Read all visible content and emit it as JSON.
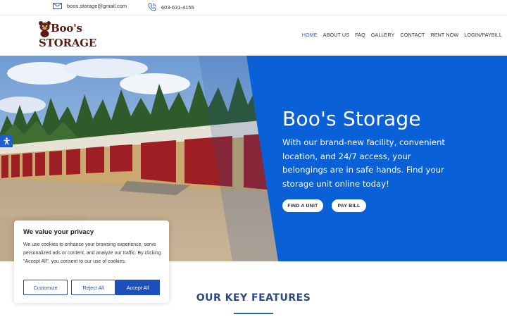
{
  "topbar": {
    "email": "boos.storage@gmail.com",
    "phone": "603-631-4155"
  },
  "logo": {
    "line1": "Boo's",
    "line2": "STORAGE"
  },
  "nav": {
    "items": [
      "HOME",
      "ABOUT US",
      "FAQ",
      "GALLERY",
      "CONTACT",
      "RENT NOW",
      "LOGIN/PAYBILL"
    ],
    "active": "HOME"
  },
  "hero": {
    "title": "Boo's Storage",
    "text": "With our brand-new facility, convenient location, and 24/7 access, your belongings are in safe hands. Find your storage unit online today!",
    "find_unit_label": "FIND A UNIT",
    "pay_bill_label": "PAY BILL"
  },
  "features": {
    "title": "OUR KEY FEATURES"
  },
  "cookie": {
    "title": "We value your privacy",
    "text": "We use cookies to enhance your browsing experience, serve personalized ads or content, and analyze our traffic. By clicking \"Accept All\", you consent to our use of cookies.",
    "customize_label": "Customize",
    "reject_label": "Reject All",
    "accept_label": "Accept All"
  },
  "colors": {
    "brand_blue": "#0a60d6",
    "nav_active": "#2e64c9",
    "logo_brown": "#5a1a14",
    "door_red": "#9e1f23"
  },
  "icons": {
    "email": "envelope-icon",
    "phone": "phone-icon",
    "accessibility": "accessibility-icon"
  }
}
